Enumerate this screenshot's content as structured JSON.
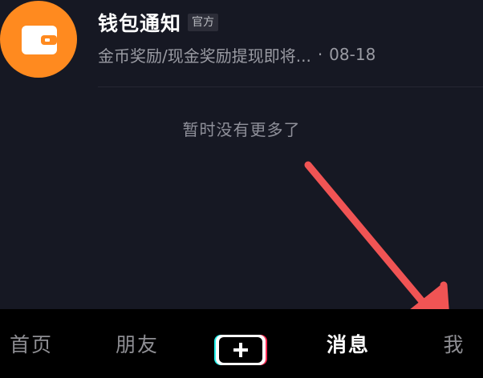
{
  "notification": {
    "title": "钱包通知",
    "badge": "官方",
    "preview": "金币奖励/现金奖励提现即将...",
    "separator": "·",
    "date": "08-18",
    "avatar_icon": "wallet-icon",
    "avatar_color": "#ff8a1f"
  },
  "list_footer": {
    "no_more_text": "暂时没有更多了"
  },
  "annotation": {
    "arrow_color": "#f05454",
    "arrow_points_to": "tab-me"
  },
  "tab_bar": {
    "tabs": [
      {
        "label": "首页",
        "active": false
      },
      {
        "label": "朋友",
        "active": false
      },
      {
        "label": "消息",
        "active": true
      },
      {
        "label": "我",
        "active": false
      }
    ],
    "create_icon": "plus-icon",
    "colors": {
      "background": "#000000",
      "active_text": "#ffffff",
      "inactive_text": "#8e8e93",
      "create_cyan": "#25f4ee",
      "create_red": "#fe2c55"
    }
  },
  "colors": {
    "background": "#161823",
    "divider": "#262733"
  }
}
